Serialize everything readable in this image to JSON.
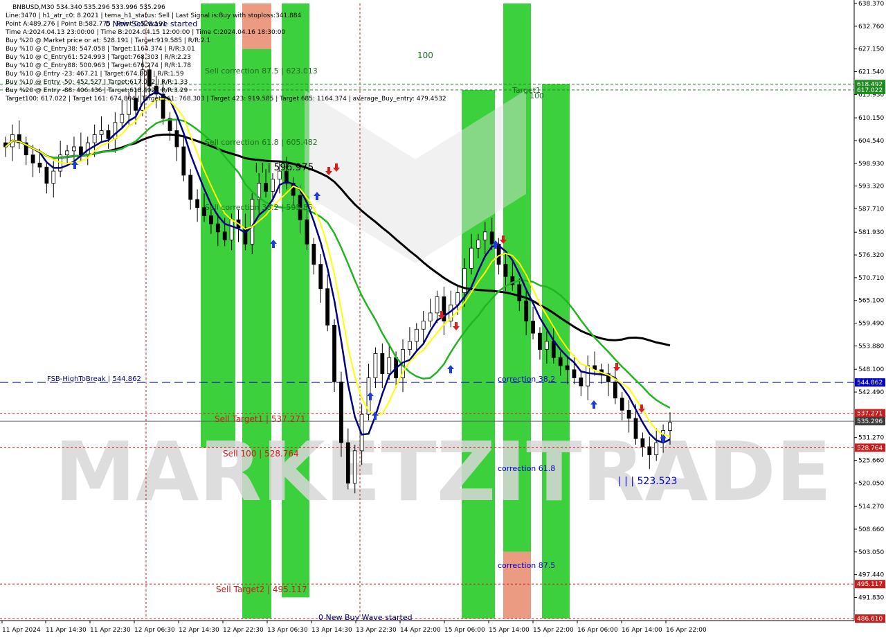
{
  "header": {
    "symbol_line": "BNBUSD,M30  534.340 535.296 533.996 535.296",
    "lines": [
      "Line:3470  |  h1_atr_c0: 8.2021  |  tema_h1_status: Sell  |  Last Signal is:Buy with stoploss:341.884",
      "Point A:489.276  |  Point B:582.775  |  Point C:528.191",
      "Time A:2024.04.13 23:00:00  |  Time B:2024.04.15 12:00:00  |  Time C:2024.04.16 18:30:00",
      "Buy %20 @ Market price or at: 528.191  |  Target:919.585  |  R/R:2.1",
      "Buy %10 @ C_Entry38: 547.058  |  Target:1164.374  |  R/R:3.01",
      "Buy %10 @ C_Entry61: 524.993  |  Target:768.303  |  R/R:2.23",
      "Buy %10 @ C_Entry88: 500.963  |  Target:676.274  |  R/R:1.78",
      "Buy %10 @ Entry -23: 467.21  |  Target:674.804  |  R/R:1.59",
      "Buy %10 @ Entry -50: 452.527  |  Target:617.022  |  R/R:1.33",
      "Buy %20 @ Entry -88: 406.436  |  Target:618.492  |  R/R:3.29",
      "Target100: 617.022  |  Target 161: 674.804  |  Target 261: 768.303  |  Target 423: 919.585  |  Target 685: 1164.374  |  average_Buy_entry: 479.4532"
    ]
  },
  "labels": {
    "new_sell_wave": "0 New Sell wave started",
    "new_buy_wave": "0 New Buy Wave started",
    "sell_corr_875": "Sell correction 87.5 | 623.013",
    "sell_corr_618": "Sell correction 61.8 | 605.482",
    "sell_corr_382": "Sell correction 38.2 | 595.85",
    "level_596": "| | | 596.975",
    "level_523": "| | | 523.523",
    "corr_382": "correction 38.2",
    "corr_618": "correction 61.8",
    "corr_875": "correction 87.5",
    "sell_target1": "Sell Target1 | 537.271",
    "sell_target2": "Sell Target2 | 495.117",
    "sell_100": "Sell 100 | 528.764",
    "fsb": "FSB-HighToBreak  |  544.862",
    "target1": "Target1",
    "hundred_top": "100",
    "hundred_mid": "100",
    "watermark": "MARKETZITRADE"
  },
  "colors": {
    "green_zone": "#32CD32",
    "orange_zone": "#E9967A",
    "sell_red": "#C81E1E",
    "fsb_blue": "#0000CD",
    "ma_black": "#000000",
    "ma_green": "#22B422",
    "ma_navy": "#000080",
    "ma_yellow": "#FFFF00"
  },
  "chart_data": {
    "type": "candlestick",
    "timeframe": "M30",
    "ylim": [
      486.61,
      638.37
    ],
    "y_ticks": [
      "638.370",
      "632.760",
      "627.150",
      "621.540",
      "615.930",
      "610.150",
      "604.540",
      "598.930",
      "593.320",
      "587.710",
      "581.930",
      "576.320",
      "570.710",
      "565.100",
      "559.490",
      "553.880",
      "548.100",
      "542.490",
      "537.271",
      "535.296",
      "531.270",
      "528.764",
      "525.660",
      "520.050",
      "514.270",
      "508.660",
      "503.050",
      "497.440",
      "495.117",
      "491.830",
      "486.610"
    ],
    "x_ticks": [
      "11 Apr 2024",
      "11 Apr 14:30",
      "11 Apr 22:30",
      "12 Apr 06:30",
      "12 Apr 14:30",
      "12 Apr 22:30",
      "13 Apr 06:30",
      "13 Apr 14:30",
      "13 Apr 22:30",
      "14 Apr 22:00",
      "15 Apr 06:00",
      "15 Apr 14:00",
      "15 Apr 22:00",
      "16 Apr 06:00",
      "16 Apr 14:00",
      "16 Apr 22:00"
    ],
    "price_tags": [
      {
        "value": 618.492,
        "label": "618.492",
        "color": "#1E8C1E"
      },
      {
        "value": 617.022,
        "label": "617.022",
        "color": "#1E8C1E"
      },
      {
        "value": 544.862,
        "label": "544.862",
        "color": "#0000CD"
      },
      {
        "value": 537.271,
        "label": "537.271",
        "color": "#C81E1E"
      },
      {
        "value": 535.296,
        "label": "535.296",
        "color": "#3C3C3C"
      },
      {
        "value": 528.764,
        "label": "528.764",
        "color": "#C81E1E"
      },
      {
        "value": 495.117,
        "label": "495.117",
        "color": "#C81E1E"
      },
      {
        "value": 486.61,
        "label": "486.610",
        "color": "#C81E1E"
      }
    ],
    "horizontal_levels": [
      {
        "name": "target-618492",
        "value": 618.492,
        "color": "#1E8C1E",
        "dash": "4,3"
      },
      {
        "name": "target-617022",
        "value": 617.022,
        "color": "#1E8C1E",
        "dash": "4,3"
      },
      {
        "name": "fsb-high-to-break",
        "value": 544.862,
        "color": "#0000CD",
        "dash": "12,6"
      },
      {
        "name": "sell-target1",
        "value": 537.271,
        "color": "#C81E1E",
        "dash": "3,3"
      },
      {
        "name": "current-price",
        "value": 535.296,
        "color": "#646464",
        "dash": ""
      },
      {
        "name": "sell-100",
        "value": 528.764,
        "color": "#C81E1E",
        "dash": "3,3"
      },
      {
        "name": "sell-target2",
        "value": 495.117,
        "color": "#C81E1E",
        "dash": "3,3"
      },
      {
        "name": "bottom-level",
        "value": 486.61,
        "color": "#C81E1E",
        "dash": "3,3"
      }
    ],
    "zones": [
      {
        "kind": "green",
        "from_bar": 0.0,
        "to_bar": 0.06,
        "top": 638.37,
        "bottom": 528.764
      },
      {
        "kind": "green",
        "from_bar": 0.08,
        "to_bar": 0.12,
        "top": 627.15,
        "bottom": 486.61
      },
      {
        "kind": "orange",
        "from_bar": 0.08,
        "to_bar": 0.12,
        "top": 638.37,
        "bottom": 627.15
      },
      {
        "kind": "green",
        "from_bar": 0.15,
        "to_bar": 0.2,
        "top": 638.37,
        "bottom": 491.83
      },
      {
        "kind": "green",
        "from_bar": 0.53,
        "to_bar": 0.58,
        "top": 617.022,
        "bottom": 486.61
      },
      {
        "kind": "green",
        "from_bar": 0.6,
        "to_bar": 0.64,
        "top": 638.37,
        "bottom": 503.05
      },
      {
        "kind": "orange",
        "from_bar": 0.6,
        "to_bar": 0.64,
        "top": 503.05,
        "bottom": 486.61
      },
      {
        "kind": "green",
        "from_bar": 0.66,
        "to_bar": 0.7,
        "top": 618.492,
        "bottom": 486.61
      }
    ],
    "candles_close": [
      603,
      606,
      604,
      601,
      599,
      598,
      594,
      597,
      601,
      602,
      603,
      601,
      604,
      606,
      607,
      605,
      609,
      611,
      615,
      612,
      622,
      618,
      616,
      610,
      607,
      603,
      596,
      590,
      588,
      586,
      584,
      582,
      580,
      585,
      583,
      579,
      590,
      594,
      592,
      595,
      597,
      594,
      591,
      585,
      579,
      574,
      568,
      559,
      545,
      530,
      520,
      528,
      537,
      546,
      552,
      547,
      551,
      546,
      553,
      555,
      558,
      560,
      562,
      566,
      560,
      564,
      567,
      573,
      578,
      580,
      582,
      579,
      574,
      571,
      569,
      565,
      560,
      557,
      553,
      555,
      551,
      549,
      548,
      546,
      544,
      549,
      548,
      547,
      545,
      541,
      538,
      536,
      531,
      529,
      527,
      530,
      533,
      535
    ]
  }
}
